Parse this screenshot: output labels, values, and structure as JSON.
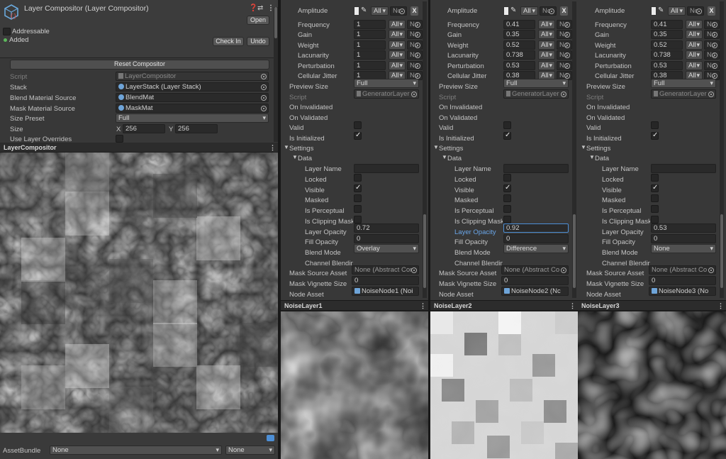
{
  "inspector": {
    "title": "Layer Compositor (Layer Compositor)",
    "open_label": "Open",
    "addressable_label": "Addressable",
    "added_label": "Added",
    "check_in_label": "Check In",
    "undo_label": "Undo",
    "reset_label": "Reset Compositor",
    "props": [
      {
        "label": "Script",
        "value": "LayerCompositor"
      },
      {
        "label": "Stack",
        "value": "LayerStack (Layer Stack)"
      },
      {
        "label": "Blend Material Source",
        "value": "BlendMat"
      },
      {
        "label": "Mask Material Source",
        "value": "MaskMat"
      },
      {
        "label": "Size Preset",
        "value": "Full"
      }
    ],
    "size_label": "Size",
    "size_x_label": "X",
    "size_x": "256",
    "size_y_label": "Y",
    "size_y": "256",
    "use_overrides_label": "Use Layer Overrides",
    "preview_tab": "LayerCompositor",
    "assetbundle_label": "AssetBundle",
    "assetbundle_value": "None",
    "assetbundle_variant": "None"
  },
  "labels": {
    "amplitude": "Amplitude",
    "frequency": "Frequency",
    "gain": "Gain",
    "weight": "Weight",
    "lacunarity": "Lacunarity",
    "perturbation": "Perturbation",
    "cellular_jitter": "Cellular Jitter",
    "preview_size": "Preview Size",
    "script": "Script",
    "on_invalidated": "On Invalidated",
    "on_validated": "On Validated",
    "valid": "Valid",
    "is_initialized": "Is Initialized",
    "settings": "Settings",
    "data": "Data",
    "layer_name": "Layer Name",
    "locked": "Locked",
    "visible": "Visible",
    "masked": "Masked",
    "is_perceptual": "Is Perceptual",
    "is_clipping_mask": "Is Clipping Mask",
    "layer_opacity": "Layer Opacity",
    "fill_opacity": "Fill Opacity",
    "blend_mode": "Blend Mode",
    "channel_blending": "Channel Blending",
    "mask_source_asset": "Mask Source Asset",
    "mask_vignette_size": "Mask Vignette Size",
    "node_asset": "Node Asset",
    "all": "All",
    "nc": "Nc",
    "x": "X"
  },
  "layers": [
    {
      "tab": "NoiseLayer1",
      "frequency": "1",
      "gain": "1",
      "weight": "1",
      "lacunarity": "1",
      "perturbation": "1",
      "jitter": "1",
      "preview_size": "Full",
      "script": "GeneratorLayer",
      "layer_opacity": "0.72",
      "fill_opacity": "0",
      "blend_mode": "Overlay",
      "mask_source": "None (Abstract Cor",
      "vignette": "0",
      "node_asset": "NoiseNode1 (Noi"
    },
    {
      "tab": "NoiseLayer2",
      "frequency": "0.41",
      "gain": "0.35",
      "weight": "0.52",
      "lacunarity": "0.738",
      "perturbation": "0.53",
      "jitter": "0.38",
      "preview_size": "Full",
      "script": "GeneratorLayer",
      "layer_opacity": "0.92",
      "fill_opacity": "0",
      "blend_mode": "Difference",
      "mask_source": "None (Abstract Co",
      "vignette": "0",
      "node_asset": "NoiseNode2 (Nc"
    },
    {
      "tab": "NoiseLayer3",
      "frequency": "0.41",
      "gain": "0.35",
      "weight": "0.52",
      "lacunarity": "0.738",
      "perturbation": "0.53",
      "jitter": "0.38",
      "preview_size": "Full",
      "script": "GeneratorLayer",
      "layer_opacity": "0.53",
      "fill_opacity": "0",
      "blend_mode": "None",
      "mask_source": "None (Abstract Co",
      "vignette": "0",
      "node_asset": "NoiseNode3 (No"
    }
  ],
  "colors": {
    "panel": "#383838",
    "field": "#2a2a2a",
    "accent": "#4d8fd6"
  }
}
